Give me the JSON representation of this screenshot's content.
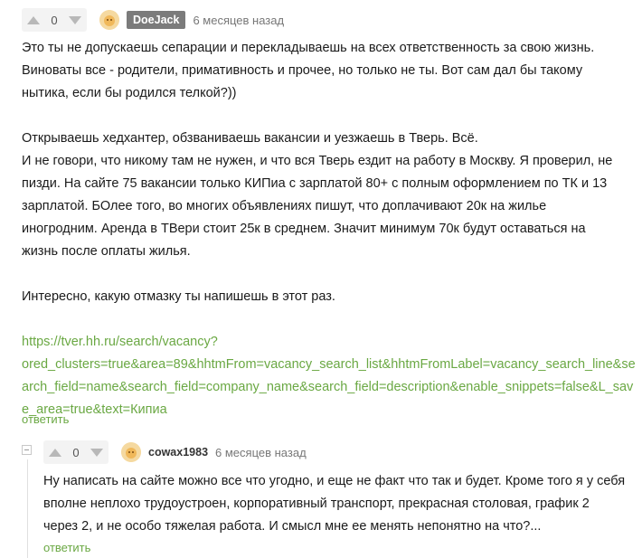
{
  "comment1": {
    "votes": "0",
    "author": "DoeJack",
    "time": "6 месяцев назад",
    "lines": [
      "Это ты не допускаешь сепарации и перекладываешь на всех ответственность за свою жизнь.",
      "Виноваты все - родители, примативность и прочее, но только не ты. Вот сам дал бы такому",
      "нытика, если бы родился телкой?))",
      "",
      "Открываешь хедхантер, обзваниваешь вакансии и уезжаешь в Тверь. Всё.",
      "И не говори, что никому там не нужен, и что вся Тверь ездит на работу в Москву. Я проверил, не",
      "пизди. На сайте 75 вакансии только КИПиа с зарплатой 80+ с полным оформлением по ТК и 13",
      "зарплатой. БОлее того, во многих объявлениях пишут, что доплачивают 20к на жилье",
      "иногродним. Аренда в ТВери стоит 25к в среднем. Значит минимум 70к будут оставаться на",
      "жизнь после оплаты жилья.",
      "",
      "Интересно, какую отмазку ты напишешь в этот раз.",
      ""
    ],
    "link_lines": [
      "https://tver.hh.ru/search/vacancy?",
      "ored_clusters=true&area=89&hhtmFrom=vacancy_search_list&hhtmFromLabel=vacancy_search_line&se",
      "arch_field=name&search_field=company_name&search_field=description&enable_snippets=false&L_sav",
      "e_area=true&text=Кипиа"
    ],
    "reply": "ответить"
  },
  "comment2": {
    "votes": "0",
    "author": "cowax1983",
    "time": "6 месяцев назад",
    "lines": [
      "Ну написать на сайте можно все что угодно, и еще не факт что так и будет. Кроме того я у себя",
      "вполне неплохо трудоустроен, корпоративный транспорт, прекрасная столовая, график 2",
      "через 2, и не особо тяжелая работа. И смысл мне ее менять непонятно на что?..."
    ],
    "reply": "ответить"
  },
  "colors": {
    "accent": "#6aa843",
    "badge": "#7b7b7b",
    "vote_bg": "#f3f3f3"
  },
  "icons": [
    "upvote-icon",
    "downvote-icon",
    "avatar-icon",
    "collapse-icon"
  ]
}
